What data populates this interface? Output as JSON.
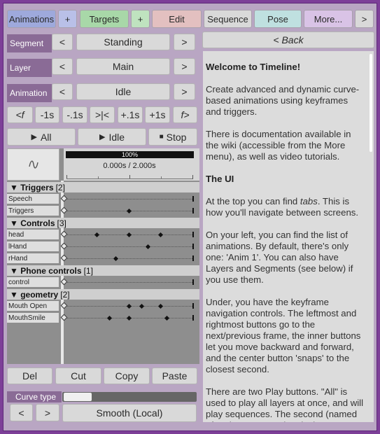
{
  "tabs": [
    {
      "label": "Animations",
      "color": "#9ea9dc"
    },
    {
      "label": "+",
      "color": "#b9c0e8"
    },
    {
      "label": "Targets",
      "color": "#a8d8a8"
    },
    {
      "label": "+",
      "color": "#bfe3bf"
    },
    {
      "label": "Edit",
      "color": "#e3c0c0"
    },
    {
      "label": "Sequence",
      "color": "#d9d9d9"
    },
    {
      "label": "Pose",
      "color": "#bfe0e0"
    },
    {
      "label": "More...",
      "color": "#d9c3e6"
    },
    {
      "label": ">",
      "color": "#d9d9d9"
    }
  ],
  "segment": {
    "label": "Segment",
    "value": "Standing",
    "prev": "<",
    "next": ">"
  },
  "layer": {
    "label": "Layer",
    "value": "Main",
    "prev": "<",
    "next": ">"
  },
  "animation": {
    "label": "Animation",
    "value": "Idle",
    "prev": "<",
    "next": ">"
  },
  "nav": [
    "<f",
    "-1s",
    "-.1s",
    ">|<",
    "+.1s",
    "+1s",
    "f>"
  ],
  "play": {
    "all": "All",
    "idle": "Idle",
    "stop": "Stop"
  },
  "timeline": {
    "zoom": "100%",
    "time": "0.000s / 2.000s"
  },
  "groups": [
    {
      "name": "▼ Triggers",
      "count": "[2]",
      "tracks": [
        {
          "name": "Speech",
          "keys": []
        },
        {
          "name": "Triggers",
          "keys": [
            0.5
          ]
        }
      ]
    },
    {
      "name": "▼ Controls",
      "count": "[3]",
      "tracks": [
        {
          "name": "head",
          "keys": [
            0.25,
            0.5,
            0.75
          ]
        },
        {
          "name": "lHand",
          "keys": [
            0.65
          ]
        },
        {
          "name": "rHand",
          "keys": [
            0.4
          ]
        }
      ]
    },
    {
      "name": "▼ Phone controls",
      "count": "[1]",
      "tracks": [
        {
          "name": "control",
          "keys": []
        }
      ]
    },
    {
      "name": "▼ geometry",
      "count": "[2]",
      "tracks": [
        {
          "name": "Mouth Open",
          "keys": [
            0.5,
            0.6,
            0.75
          ]
        },
        {
          "name": "MouthSmile",
          "keys": [
            0.35,
            0.5,
            0.8
          ]
        }
      ]
    }
  ],
  "edit": {
    "del": "Del",
    "cut": "Cut",
    "copy": "Copy",
    "paste": "Paste"
  },
  "curve": {
    "label": "Curve type",
    "prev": "<",
    "next": ">",
    "value": "Smooth (Local)"
  },
  "back": "< Back",
  "doc": {
    "title": "Welcome to Timeline!",
    "p1": "Create advanced and dynamic curve-based animations using keyframes and triggers.",
    "p2": "There is documentation available in the wiki (accessible from the More menu), as well as video tutorials.",
    "h2": "The UI",
    "p3a": "At the top you can find ",
    "p3em": "tabs",
    "p3b": ". This is how you'll navigate between screens.",
    "p4": "On your left, you can find the list of animations. By default, there's only one: 'Anim 1'. You can also have Layers and Segments (see below) if you use them.",
    "p5": "Under, you have the keyframe navigation controls. The leftmost and rightmost buttons go to the next/previous frame, the inner buttons let you move backward and forward, and the center button 'snaps' to the closest second.",
    "p6": "There are two Play buttons. \"All\" is used to play all layers at once, and will play sequences. The second (named after the current animation)"
  }
}
